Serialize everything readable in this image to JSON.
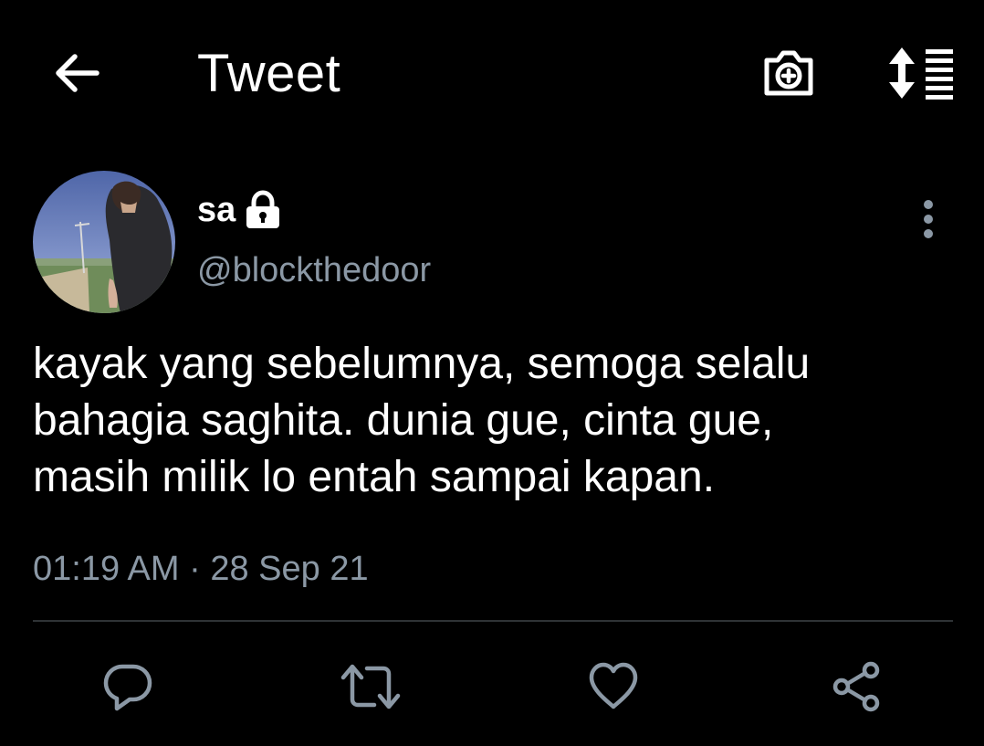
{
  "header": {
    "title": "Tweet",
    "back_icon": "arrow-left-icon",
    "camera_icon": "camera-add-icon",
    "sort_icon": "sort-list-icon"
  },
  "tweet": {
    "author": {
      "display_name": "sa",
      "handle": "@blockthedoor",
      "protected": true,
      "lock_icon": "lock-icon"
    },
    "text_lines": [
      "kayak yang sebelumnya, semoga selalu",
      "bahagia saghita. dunia gue, cinta gue,",
      "masih milik lo entah sampai kapan."
    ],
    "timestamp": "01:19 AM · 28 Sep 21"
  },
  "actions": [
    {
      "icon": "reply-icon"
    },
    {
      "icon": "retweet-icon"
    },
    {
      "icon": "like-icon"
    },
    {
      "icon": "share-icon"
    }
  ],
  "colors": {
    "background": "#000000",
    "text_primary": "#ffffff",
    "text_secondary": "#8b98a5",
    "divider": "#2f3336",
    "icon_secondary": "#8b98a5"
  }
}
